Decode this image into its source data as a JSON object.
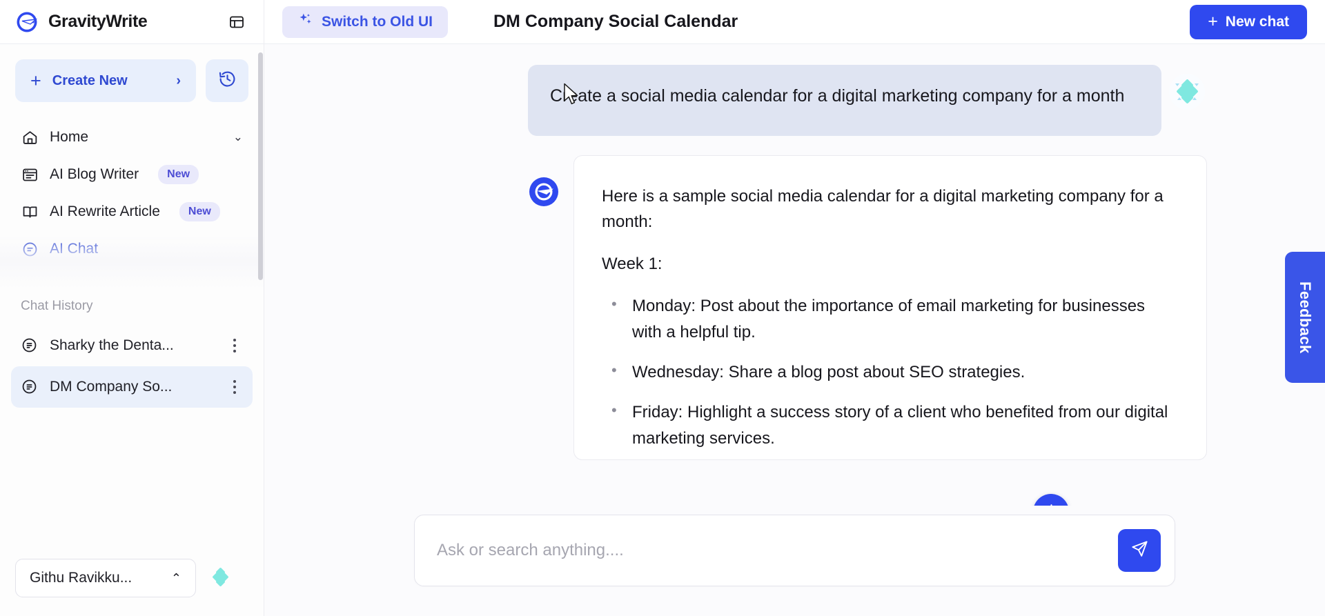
{
  "brand": {
    "name": "GravityWrite",
    "logo_icon": "gravitywrite-logo-icon",
    "panel_toggle_icon": "panel-toggle-icon"
  },
  "sidebar": {
    "create_new": {
      "label": "Create New",
      "plus": "+",
      "chevron": "›",
      "icon": "plus-icon"
    },
    "history_button_icon": "history-clock-icon",
    "nav_items": [
      {
        "label": "Home",
        "icon": "home-icon",
        "badge": "",
        "chevron": "⌄",
        "active": false
      },
      {
        "label": "AI Blog Writer",
        "icon": "blog-window-icon",
        "badge": "New",
        "active": false
      },
      {
        "label": "AI Rewrite Article",
        "icon": "open-book-icon",
        "badge": "New",
        "active": false
      },
      {
        "label": "AI Chat",
        "icon": "chat-circle-icon",
        "badge": "",
        "active": true
      }
    ],
    "chat_history_label": "Chat History",
    "chat_history": [
      {
        "label": "Sharky the Denta...",
        "icon": "chat-doc-icon",
        "selected": false,
        "menu_icon": "kebab-menu-icon"
      },
      {
        "label": "DM Company So...",
        "icon": "chat-doc-icon",
        "selected": true,
        "menu_icon": "kebab-menu-icon"
      }
    ],
    "user": {
      "name": "Githu Ravikku...",
      "caret": "⌃"
    },
    "footer_decoration_icon": "cyan-sparkle-icon"
  },
  "topbar": {
    "switch_ui_label": "Switch to Old UI",
    "switch_ui_icon": "sparkle-icon",
    "page_title": "DM Company Social Calendar",
    "new_chat_label": "New chat",
    "new_chat_plus": "+"
  },
  "conversation": {
    "user_message": "Create a social media calendar for a digital marketing company for a month",
    "user_decoration_icon": "cyan-sparkle-icon",
    "assistant_avatar_icon": "gravitywrite-avatar-icon",
    "assistant_intro": "Here is a sample social media calendar for a digital marketing company for a month:",
    "assistant_week_heading": "Week 1:",
    "assistant_bullets": [
      "Monday: Post about the importance of email marketing for businesses with a helpful tip.",
      "Wednesday: Share a blog post about SEO strategies.",
      "Friday: Highlight a success story of a client who benefited from our digital marketing services."
    ],
    "scroll_down_icon": "arrow-down-icon"
  },
  "composer": {
    "placeholder": "Ask or search anything....",
    "value": "",
    "send_icon": "send-paper-plane-icon"
  },
  "widgets": {
    "feedback_label": "Feedback",
    "support_icon": "chat-bubble-icon"
  },
  "colors": {
    "brand_blue": "#2f49ef",
    "accent_light_blue": "#e8effc",
    "switch_bg": "#e8e8fb",
    "user_bubble": "#dfe4f2",
    "cyan_accent": "#7fe8e0"
  }
}
